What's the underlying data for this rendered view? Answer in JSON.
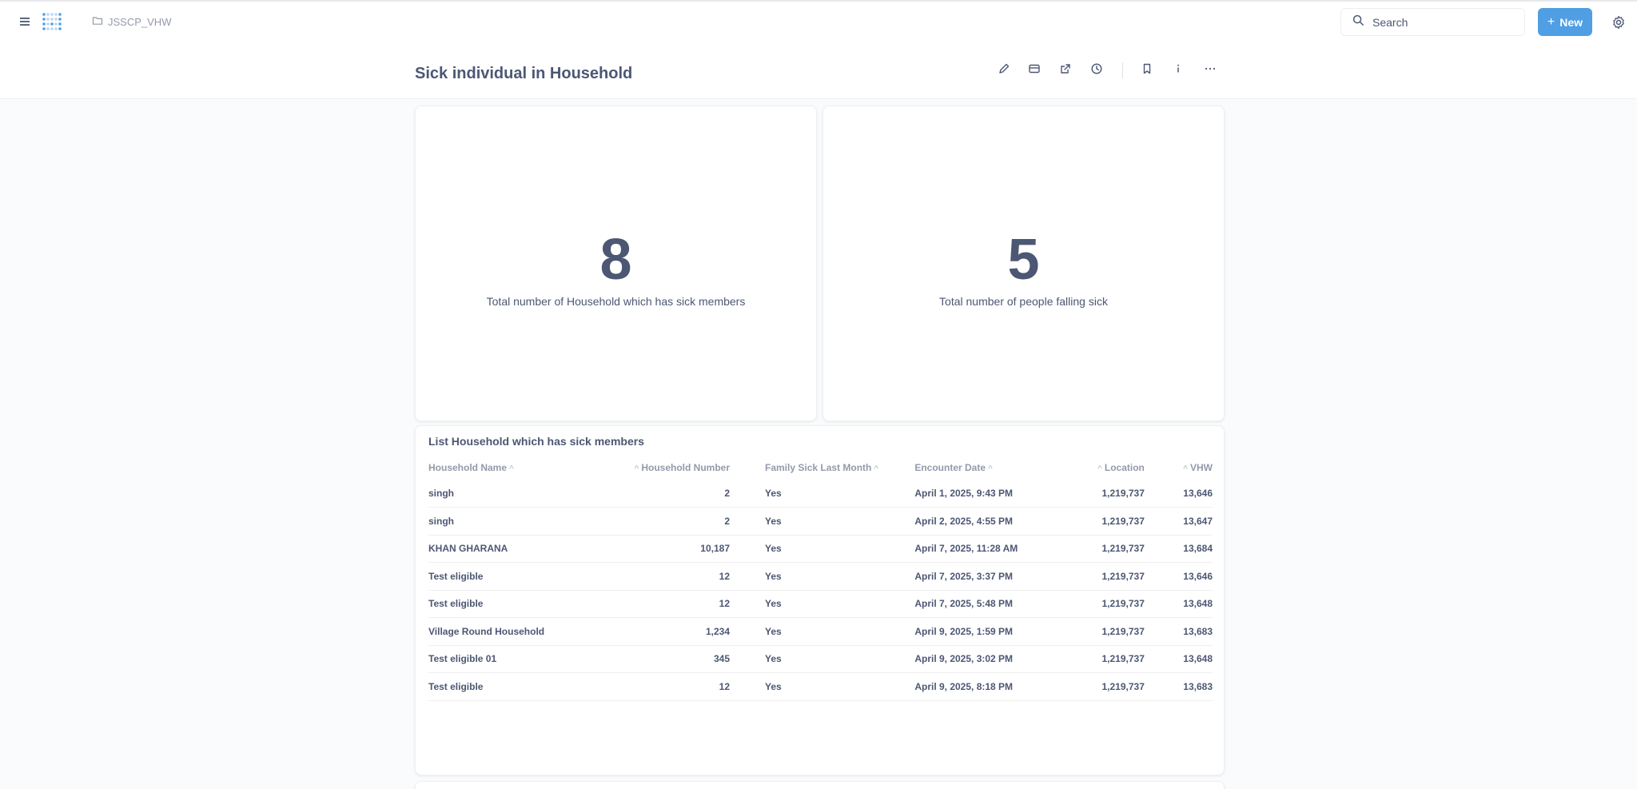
{
  "nav": {
    "breadcrumb": "JSSCP_VHW",
    "search_placeholder": "Search",
    "new_label": "New"
  },
  "dashboard": {
    "title": "Sick individual in Household"
  },
  "scalars": [
    {
      "value": "8",
      "label": "Total number of Household which has sick members"
    },
    {
      "value": "5",
      "label": "Total number of people falling sick"
    }
  ],
  "table": {
    "title": "List Household which has sick members",
    "columns": [
      "Household Name",
      "Household Number",
      "Family Sick Last Month",
      "Encounter Date",
      "Location",
      "VHW"
    ],
    "rows": [
      [
        "singh",
        "2",
        "Yes",
        "April 1, 2025, 9:43 PM",
        "1,219,737",
        "13,646"
      ],
      [
        "singh",
        "2",
        "Yes",
        "April 2, 2025, 4:55 PM",
        "1,219,737",
        "13,647"
      ],
      [
        "KHAN GHARANA",
        "10,187",
        "Yes",
        "April 7, 2025, 11:28 AM",
        "1,219,737",
        "13,684"
      ],
      [
        "Test eligible",
        "12",
        "Yes",
        "April 7, 2025, 3:37 PM",
        "1,219,737",
        "13,646"
      ],
      [
        "Test eligible",
        "12",
        "Yes",
        "April 7, 2025, 5:48 PM",
        "1,219,737",
        "13,648"
      ],
      [
        "Village Round Household",
        "1,234",
        "Yes",
        "April 9, 2025, 1:59 PM",
        "1,219,737",
        "13,683"
      ],
      [
        "Test eligible 01",
        "345",
        "Yes",
        "April 9, 2025, 3:02 PM",
        "1,219,737",
        "13,648"
      ],
      [
        "Test eligible",
        "12",
        "Yes",
        "April 9, 2025, 8:18 PM",
        "1,219,737",
        "13,683"
      ]
    ]
  },
  "colors": {
    "accent": "#509ee3",
    "text": "#4c5773",
    "muted": "#949aab"
  }
}
